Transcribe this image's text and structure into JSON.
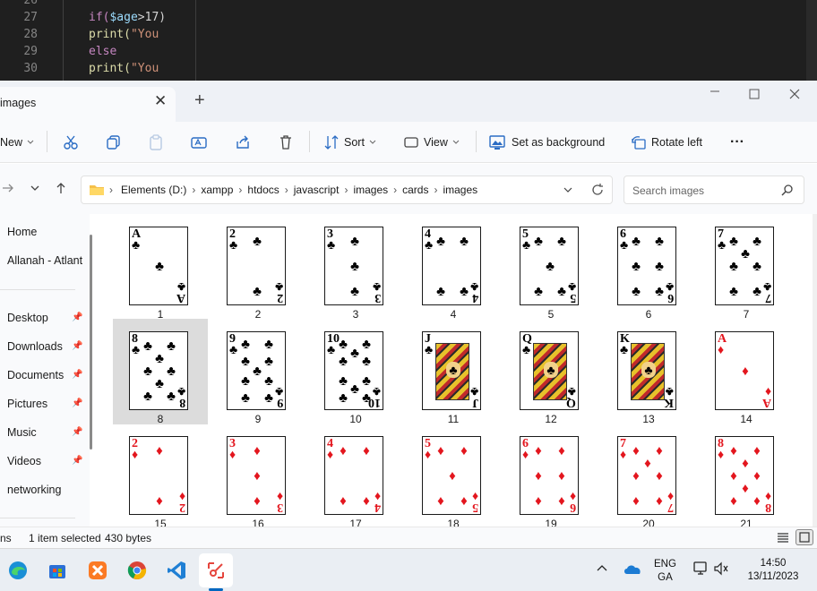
{
  "editor": {
    "lines": [
      {
        "num": "26",
        "code": ""
      },
      {
        "num": "27",
        "code_a": "if(",
        "code_b": "$age",
        "code_c": ">17)"
      },
      {
        "num": "28",
        "code_a": "print(",
        "code_b": "\"You",
        "code_c": ""
      },
      {
        "num": "29",
        "code_a": "else",
        "code_b": "",
        "code_c": ""
      },
      {
        "num": "30",
        "code_a": "print(",
        "code_b": "\"You",
        "code_c": ""
      }
    ]
  },
  "window": {
    "tab_title": "images",
    "close_tab": "✕",
    "new_tab": "+"
  },
  "toolbar": {
    "new_label": "New",
    "sort_label": "Sort",
    "view_label": "View",
    "set_bg_label": "Set as background",
    "rotate_left_label": "Rotate left",
    "more_label": "···"
  },
  "address": {
    "crumbs": [
      "Elements (D:)",
      "xampp",
      "htdocs",
      "javascript",
      "images",
      "cards",
      "images"
    ],
    "search_placeholder": "Search images"
  },
  "sidebar": {
    "items": [
      {
        "label": "Home",
        "pinned": false
      },
      {
        "label": "Allanah - Atlant",
        "pinned": false
      },
      {
        "label": "Desktop",
        "pinned": true
      },
      {
        "label": "Downloads",
        "pinned": true
      },
      {
        "label": "Documents",
        "pinned": true
      },
      {
        "label": "Pictures",
        "pinned": true
      },
      {
        "label": "Music",
        "pinned": true
      },
      {
        "label": "Videos",
        "pinned": true
      },
      {
        "label": "networking",
        "pinned": false
      }
    ]
  },
  "files": [
    {
      "name": "1",
      "rank": "A",
      "suit": "club",
      "color": "black"
    },
    {
      "name": "2",
      "rank": "2",
      "suit": "club",
      "color": "black"
    },
    {
      "name": "3",
      "rank": "3",
      "suit": "club",
      "color": "black"
    },
    {
      "name": "4",
      "rank": "4",
      "suit": "club",
      "color": "black"
    },
    {
      "name": "5",
      "rank": "5",
      "suit": "club",
      "color": "black"
    },
    {
      "name": "6",
      "rank": "6",
      "suit": "club",
      "color": "black"
    },
    {
      "name": "7",
      "rank": "7",
      "suit": "club",
      "color": "black"
    },
    {
      "name": "8",
      "rank": "8",
      "suit": "club",
      "color": "black",
      "selected": true
    },
    {
      "name": "9",
      "rank": "9",
      "suit": "club",
      "color": "black"
    },
    {
      "name": "10",
      "rank": "10",
      "suit": "club",
      "color": "black"
    },
    {
      "name": "11",
      "rank": "J",
      "suit": "club",
      "color": "black",
      "face": true
    },
    {
      "name": "12",
      "rank": "Q",
      "suit": "club",
      "color": "black",
      "face": true
    },
    {
      "name": "13",
      "rank": "K",
      "suit": "club",
      "color": "black",
      "face": true
    },
    {
      "name": "14",
      "rank": "A",
      "suit": "diamond",
      "color": "red"
    },
    {
      "name": "15",
      "rank": "2",
      "suit": "diamond",
      "color": "red"
    },
    {
      "name": "16",
      "rank": "3",
      "suit": "diamond",
      "color": "red"
    },
    {
      "name": "17",
      "rank": "4",
      "suit": "diamond",
      "color": "red"
    },
    {
      "name": "18",
      "rank": "5",
      "suit": "diamond",
      "color": "red"
    },
    {
      "name": "19",
      "rank": "6",
      "suit": "diamond",
      "color": "red"
    },
    {
      "name": "20",
      "rank": "7",
      "suit": "diamond",
      "color": "red"
    },
    {
      "name": "21",
      "rank": "8",
      "suit": "diamond",
      "color": "red"
    }
  ],
  "status": {
    "items_label": "ns",
    "selected_label": "1 item selected",
    "size_label": "430 bytes"
  },
  "taskbar": {
    "apps": [
      "edge-icon",
      "store-icon",
      "xampp-icon",
      "chrome-icon",
      "vscode-icon",
      "snipping-tool-icon"
    ],
    "lang_top": "ENG",
    "lang_bottom": "GA",
    "time": "14:50",
    "date": "13/11/2023"
  },
  "colors": {
    "accent": "#0067c0",
    "red_suit": "#e3161e",
    "selection": "#dcdcdc"
  }
}
